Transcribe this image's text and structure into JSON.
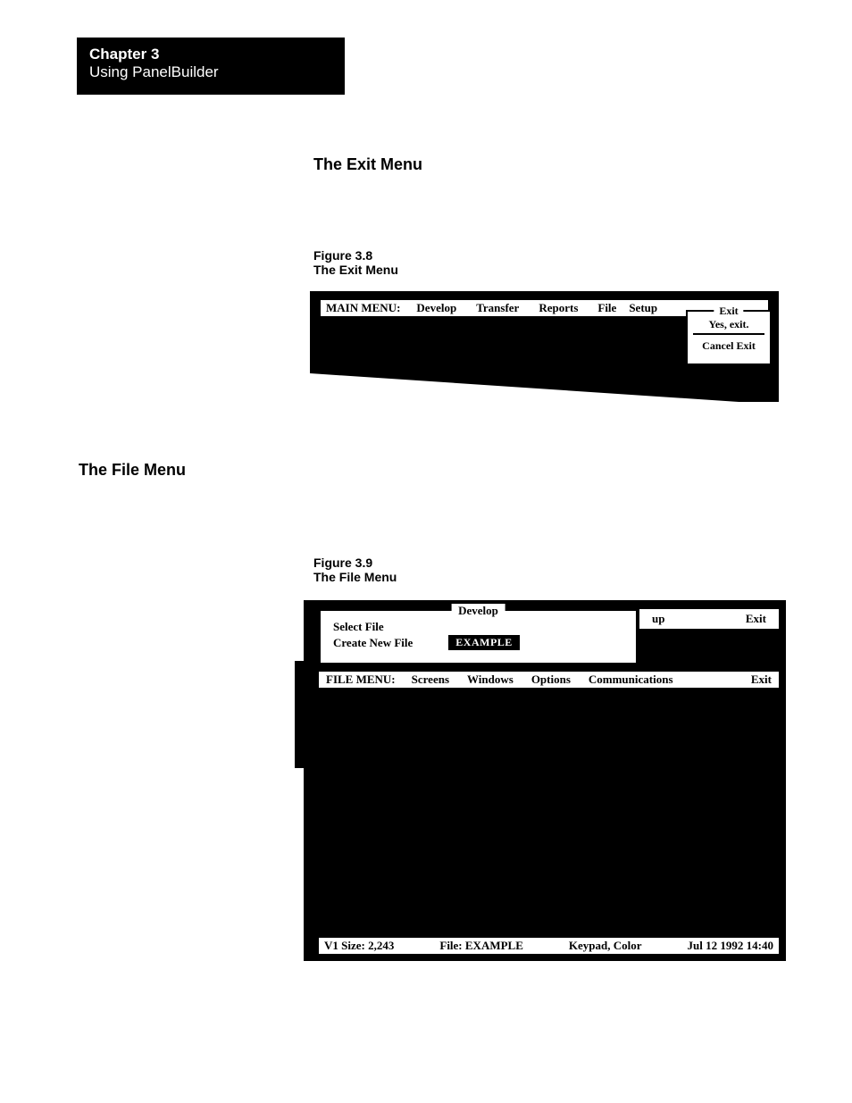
{
  "chapter": {
    "title": "Chapter 3",
    "subtitle": "Using PanelBuilder"
  },
  "sections": {
    "exit_heading": "The Exit Menu",
    "file_heading": "The File Menu",
    "fig38_num": "Figure 3.8",
    "fig38_title": "The Exit Menu",
    "fig39_num": "Figure 3.9",
    "fig39_title": "The File Menu"
  },
  "exit_fig": {
    "menubar_label": "MAIN MENU:",
    "items": {
      "develop": "Develop",
      "transfer": "Transfer",
      "reports": "Reports",
      "file": "File",
      "setup": "Setup"
    },
    "popup": {
      "legend": "Exit",
      "yes": "Yes, exit.",
      "cancel": "Cancel Exit"
    }
  },
  "file_fig": {
    "dev_legend": "Develop",
    "select_file": "Select File",
    "create_new": "Create New File",
    "example": "EXAMPLE",
    "top_right": {
      "up": "up",
      "exit": "Exit"
    },
    "menubar_label": "FILE MENU:",
    "items": {
      "screens": "Screens",
      "windows": "Windows",
      "options": "Options",
      "comms": "Communications",
      "exit": "Exit"
    },
    "status": {
      "size": "V1 Size:  2,243",
      "file": "File:  EXAMPLE",
      "mode": "Keypad, Color",
      "datetime": "Jul 12 1992 14:40"
    }
  }
}
